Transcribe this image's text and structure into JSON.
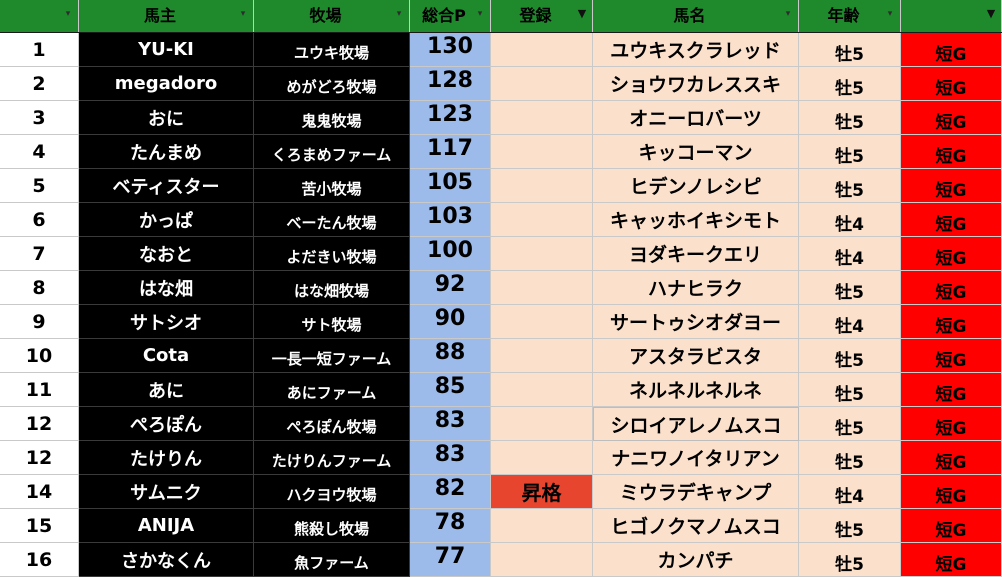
{
  "headers": {
    "num": "",
    "owner": "馬主",
    "farm": "牧場",
    "points": "総合P",
    "registration": "登録",
    "horse": "馬名",
    "age": "年齢",
    "category": ""
  },
  "colors": {
    "header": "#1f8a2c",
    "owner_bg": "#000000",
    "points_bg": "#9dbbea",
    "peach": "#fbe1cc",
    "promoted": "#e8452f",
    "category_bg": "#ff0000"
  },
  "rows": [
    {
      "rank": "1",
      "owner": "YU-KI",
      "farm": "ユウキ牧場",
      "points": "130",
      "registration": "",
      "horse": "ユウキスクラレッド",
      "age": "牡5",
      "category": "短G"
    },
    {
      "rank": "2",
      "owner": "megadoro",
      "farm": "めがどろ牧場",
      "points": "128",
      "registration": "",
      "horse": "ショウワカレススキ",
      "age": "牡5",
      "category": "短G"
    },
    {
      "rank": "3",
      "owner": "おに",
      "farm": "鬼鬼牧場",
      "points": "123",
      "registration": "",
      "horse": "オニーロバーツ",
      "age": "牡5",
      "category": "短G"
    },
    {
      "rank": "4",
      "owner": "たんまめ",
      "farm": "くろまめファーム",
      "points": "117",
      "registration": "",
      "horse": "キッコーマン",
      "age": "牡5",
      "category": "短G"
    },
    {
      "rank": "5",
      "owner": "ベティスター",
      "farm": "苦小牧場",
      "points": "105",
      "registration": "",
      "horse": "ヒデンノレシピ",
      "age": "牡5",
      "category": "短G"
    },
    {
      "rank": "6",
      "owner": "かっぱ",
      "farm": "べーたん牧場",
      "points": "103",
      "registration": "",
      "horse": "キャッホイキシモト",
      "age": "牡4",
      "category": "短G"
    },
    {
      "rank": "7",
      "owner": "なおと",
      "farm": "よだきい牧場",
      "points": "100",
      "registration": "",
      "horse": "ヨダキークエリ",
      "age": "牡4",
      "category": "短G"
    },
    {
      "rank": "8",
      "owner": "はな畑",
      "farm": "はな畑牧場",
      "points": "92",
      "registration": "",
      "horse": "ハナヒラク",
      "age": "牡5",
      "category": "短G"
    },
    {
      "rank": "9",
      "owner": "サトシオ",
      "farm": "サト牧場",
      "points": "90",
      "registration": "",
      "horse": "サートゥシオダヨー",
      "age": "牡4",
      "category": "短G"
    },
    {
      "rank": "10",
      "owner": "Cota",
      "farm": "一長一短ファーム",
      "points": "88",
      "registration": "",
      "horse": "アスタラビスタ",
      "age": "牡5",
      "category": "短G"
    },
    {
      "rank": "11",
      "owner": "あに",
      "farm": "あにファーム",
      "points": "85",
      "registration": "",
      "horse": "ネルネルネルネ",
      "age": "牡5",
      "category": "短G"
    },
    {
      "rank": "12",
      "owner": "ぺろぽん",
      "farm": "ぺろぽん牧場",
      "points": "83",
      "registration": "",
      "horse": "シロイアレノムスコ",
      "age": "牡5",
      "category": "短G"
    },
    {
      "rank": "12",
      "owner": "たけりん",
      "farm": "たけりんファーム",
      "points": "83",
      "registration": "",
      "horse": "ナニワノイタリアン",
      "age": "牡5",
      "category": "短G"
    },
    {
      "rank": "14",
      "owner": "サムニク",
      "farm": "ハクヨウ牧場",
      "points": "82",
      "registration": "昇格",
      "horse": "ミウラデキャンプ",
      "age": "牡4",
      "category": "短G"
    },
    {
      "rank": "15",
      "owner": "ANIJA",
      "farm": "熊殺し牧場",
      "points": "78",
      "registration": "",
      "horse": "ヒゴノクマノムスコ",
      "age": "牡5",
      "category": "短G"
    },
    {
      "rank": "16",
      "owner": "さかなくん",
      "farm": "魚ファーム",
      "points": "77",
      "registration": "",
      "horse": "カンパチ",
      "age": "牡5",
      "category": "短G"
    }
  ]
}
